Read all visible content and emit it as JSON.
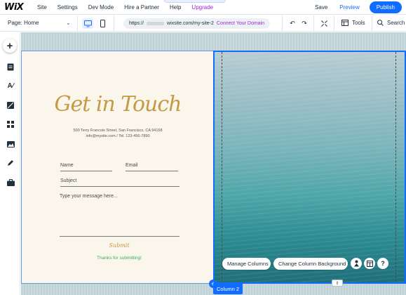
{
  "topbar": {
    "logo": "WiX",
    "menu": [
      "Site",
      "Settings",
      "Dev Mode",
      "Hire a Partner",
      "Help",
      "Upgrade"
    ],
    "save": "Save",
    "preview": "Preview",
    "publish": "Publish"
  },
  "secondbar": {
    "page_label": "Page: Home",
    "url_prefix": "https://",
    "url_suffix": "wixsite.com/my-site-2",
    "connect_domain": "Connect Your Domain",
    "tools": "Tools",
    "search": "Search"
  },
  "form": {
    "heading": "Get in Touch",
    "address_line1": "500 Terry Francois Street, San Francisco, CA 94158",
    "address_line2": "info@mysite.com  /  Tel. 123-456-7890",
    "name_placeholder": "Name",
    "email_placeholder": "Email",
    "subject_placeholder": "Subject",
    "message_placeholder": "Type your message here...",
    "submit": "Submit",
    "thanks": "Thanks for submitting!"
  },
  "column_toolbar": {
    "manage_columns": "Manage Columns",
    "change_background": "Change Column Background",
    "help": "?"
  },
  "selection": {
    "column_label": "Column 2"
  },
  "colors": {
    "accent": "#116dff",
    "upgrade": "#9a27d5",
    "heading_gold": "#c59a45",
    "thanks_green": "#3fae5a"
  }
}
